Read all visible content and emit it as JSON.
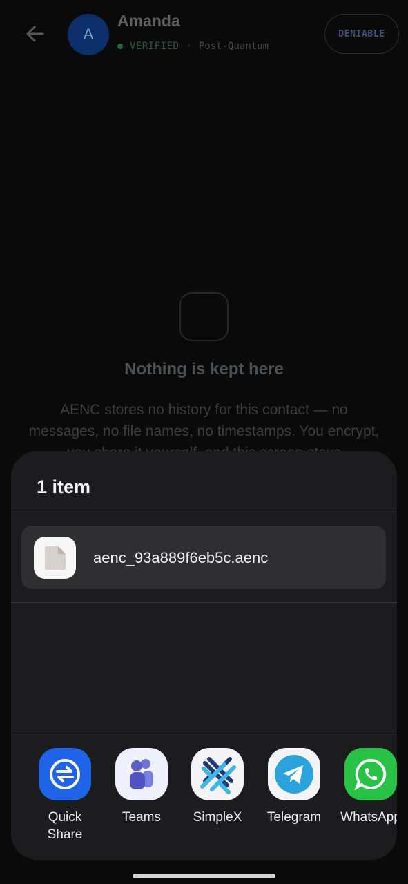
{
  "chat": {
    "contact_name": "Amanda",
    "avatar_initial": "A",
    "status_verified": "VERIFIED",
    "status_separator": "·",
    "status_protocol": "Post-Quantum",
    "mode_button": "DENIABLE",
    "empty_title": "Nothing is kept here",
    "empty_body": "AENC stores no history for this contact — no messages, no file names, no timestamps. You encrypt, you share it yourself, and this screen stays"
  },
  "share_sheet": {
    "title": "1 item",
    "file_name": "aenc_93a889f6eb5c.aenc",
    "apps": [
      {
        "label": "Quick\nShare",
        "icon": "quick-share-icon"
      },
      {
        "label": "Teams",
        "icon": "teams-icon"
      },
      {
        "label": "SimpleX",
        "icon": "simplex-icon"
      },
      {
        "label": "Telegram",
        "icon": "telegram-icon"
      },
      {
        "label": "WhatsApp",
        "icon": "whatsapp-icon"
      }
    ]
  },
  "colors": {
    "avatar": "#0c2f6b",
    "verified": "#275c37",
    "sheet_background": "#1c1c1e",
    "quick_share": "#1f63e9",
    "telegram": "#2aa3dc",
    "whatsapp": "#27c246"
  }
}
